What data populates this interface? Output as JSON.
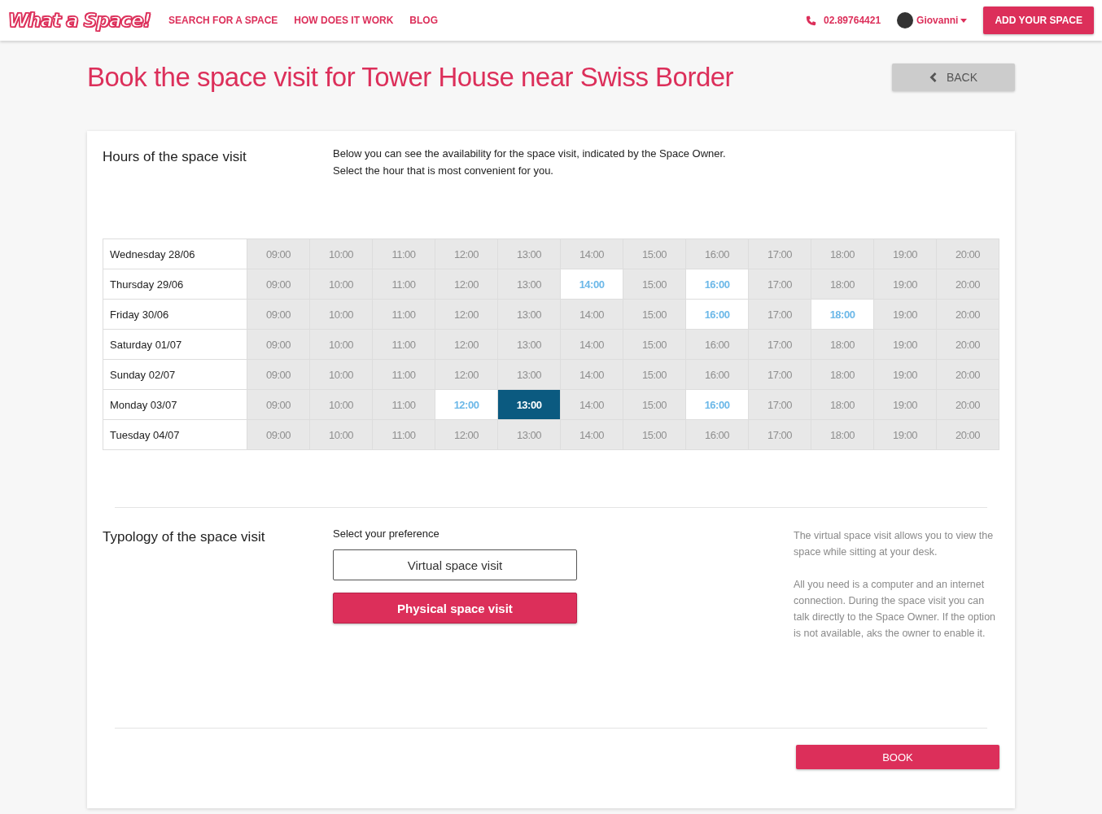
{
  "header": {
    "logo": "What a Space!",
    "nav": [
      {
        "label": "SEARCH FOR A SPACE"
      },
      {
        "label": "HOW DOES IT WORK"
      },
      {
        "label": "BLOG"
      }
    ],
    "phone": "02.89764421",
    "user": "Giovanni",
    "cta": "ADD YOUR SPACE"
  },
  "page": {
    "title": "Book the space visit for Tower House near Swiss Border",
    "back": "BACK"
  },
  "hours": {
    "heading": "Hours of the space visit",
    "intro": [
      "Below you can see the availability for the space  visit, indicated by the Space Owner.",
      "Select the hour that is most convenient for you."
    ],
    "rows": [
      {
        "day": "Wednesday 28/06",
        "slots": [
          {
            "time": "09:00",
            "available": false,
            "selected": false
          },
          {
            "time": "10:00",
            "available": false,
            "selected": false
          },
          {
            "time": "11:00",
            "available": false,
            "selected": false
          },
          {
            "time": "12:00",
            "available": false,
            "selected": false
          },
          {
            "time": "13:00",
            "available": false,
            "selected": false
          },
          {
            "time": "14:00",
            "available": false,
            "selected": false
          },
          {
            "time": "15:00",
            "available": false,
            "selected": false
          },
          {
            "time": "16:00",
            "available": false,
            "selected": false
          },
          {
            "time": "17:00",
            "available": false,
            "selected": false
          },
          {
            "time": "18:00",
            "available": false,
            "selected": false
          },
          {
            "time": "19:00",
            "available": false,
            "selected": false
          },
          {
            "time": "20:00",
            "available": false,
            "selected": false
          }
        ]
      },
      {
        "day": "Thursday 29/06",
        "slots": [
          {
            "time": "09:00",
            "available": false,
            "selected": false
          },
          {
            "time": "10:00",
            "available": false,
            "selected": false
          },
          {
            "time": "11:00",
            "available": false,
            "selected": false
          },
          {
            "time": "12:00",
            "available": false,
            "selected": false
          },
          {
            "time": "13:00",
            "available": false,
            "selected": false
          },
          {
            "time": "14:00",
            "available": true,
            "selected": false
          },
          {
            "time": "15:00",
            "available": false,
            "selected": false
          },
          {
            "time": "16:00",
            "available": true,
            "selected": false
          },
          {
            "time": "17:00",
            "available": false,
            "selected": false
          },
          {
            "time": "18:00",
            "available": false,
            "selected": false
          },
          {
            "time": "19:00",
            "available": false,
            "selected": false
          },
          {
            "time": "20:00",
            "available": false,
            "selected": false
          }
        ]
      },
      {
        "day": "Friday 30/06",
        "slots": [
          {
            "time": "09:00",
            "available": false,
            "selected": false
          },
          {
            "time": "10:00",
            "available": false,
            "selected": false
          },
          {
            "time": "11:00",
            "available": false,
            "selected": false
          },
          {
            "time": "12:00",
            "available": false,
            "selected": false
          },
          {
            "time": "13:00",
            "available": false,
            "selected": false
          },
          {
            "time": "14:00",
            "available": false,
            "selected": false
          },
          {
            "time": "15:00",
            "available": false,
            "selected": false
          },
          {
            "time": "16:00",
            "available": true,
            "selected": false
          },
          {
            "time": "17:00",
            "available": false,
            "selected": false
          },
          {
            "time": "18:00",
            "available": true,
            "selected": false
          },
          {
            "time": "19:00",
            "available": false,
            "selected": false
          },
          {
            "time": "20:00",
            "available": false,
            "selected": false
          }
        ]
      },
      {
        "day": "Saturday 01/07",
        "slots": [
          {
            "time": "09:00",
            "available": false,
            "selected": false
          },
          {
            "time": "10:00",
            "available": false,
            "selected": false
          },
          {
            "time": "11:00",
            "available": false,
            "selected": false
          },
          {
            "time": "12:00",
            "available": false,
            "selected": false
          },
          {
            "time": "13:00",
            "available": false,
            "selected": false
          },
          {
            "time": "14:00",
            "available": false,
            "selected": false
          },
          {
            "time": "15:00",
            "available": false,
            "selected": false
          },
          {
            "time": "16:00",
            "available": false,
            "selected": false
          },
          {
            "time": "17:00",
            "available": false,
            "selected": false
          },
          {
            "time": "18:00",
            "available": false,
            "selected": false
          },
          {
            "time": "19:00",
            "available": false,
            "selected": false
          },
          {
            "time": "20:00",
            "available": false,
            "selected": false
          }
        ]
      },
      {
        "day": "Sunday 02/07",
        "slots": [
          {
            "time": "09:00",
            "available": false,
            "selected": false
          },
          {
            "time": "10:00",
            "available": false,
            "selected": false
          },
          {
            "time": "11:00",
            "available": false,
            "selected": false
          },
          {
            "time": "12:00",
            "available": false,
            "selected": false
          },
          {
            "time": "13:00",
            "available": false,
            "selected": false
          },
          {
            "time": "14:00",
            "available": false,
            "selected": false
          },
          {
            "time": "15:00",
            "available": false,
            "selected": false
          },
          {
            "time": "16:00",
            "available": false,
            "selected": false
          },
          {
            "time": "17:00",
            "available": false,
            "selected": false
          },
          {
            "time": "18:00",
            "available": false,
            "selected": false
          },
          {
            "time": "19:00",
            "available": false,
            "selected": false
          },
          {
            "time": "20:00",
            "available": false,
            "selected": false
          }
        ]
      },
      {
        "day": "Monday 03/07",
        "slots": [
          {
            "time": "09:00",
            "available": false,
            "selected": false
          },
          {
            "time": "10:00",
            "available": false,
            "selected": false
          },
          {
            "time": "11:00",
            "available": false,
            "selected": false
          },
          {
            "time": "12:00",
            "available": true,
            "selected": false
          },
          {
            "time": "13:00",
            "available": true,
            "selected": true
          },
          {
            "time": "14:00",
            "available": false,
            "selected": false
          },
          {
            "time": "15:00",
            "available": false,
            "selected": false
          },
          {
            "time": "16:00",
            "available": true,
            "selected": false
          },
          {
            "time": "17:00",
            "available": false,
            "selected": false
          },
          {
            "time": "18:00",
            "available": false,
            "selected": false
          },
          {
            "time": "19:00",
            "available": false,
            "selected": false
          },
          {
            "time": "20:00",
            "available": false,
            "selected": false
          }
        ]
      },
      {
        "day": "Tuesday 04/07",
        "slots": [
          {
            "time": "09:00",
            "available": false,
            "selected": false
          },
          {
            "time": "10:00",
            "available": false,
            "selected": false
          },
          {
            "time": "11:00",
            "available": false,
            "selected": false
          },
          {
            "time": "12:00",
            "available": false,
            "selected": false
          },
          {
            "time": "13:00",
            "available": false,
            "selected": false
          },
          {
            "time": "14:00",
            "available": false,
            "selected": false
          },
          {
            "time": "15:00",
            "available": false,
            "selected": false
          },
          {
            "time": "16:00",
            "available": false,
            "selected": false
          },
          {
            "time": "17:00",
            "available": false,
            "selected": false
          },
          {
            "time": "18:00",
            "available": false,
            "selected": false
          },
          {
            "time": "19:00",
            "available": false,
            "selected": false
          },
          {
            "time": "20:00",
            "available": false,
            "selected": false
          }
        ]
      }
    ]
  },
  "typology": {
    "heading": "Typology of the space visit",
    "prompt": "Select your preference",
    "options": [
      {
        "label": "Virtual space visit",
        "selected": false
      },
      {
        "label": "Physical space visit",
        "selected": true
      }
    ],
    "notes": [
      "The virtual space visit allows you to view the space while sitting at your desk.",
      "All you need is a computer and an internet connection. During the space visit you can talk directly to the Space Owner. If the option is not available, aks the owner to enable it."
    ]
  },
  "book": "BOOK"
}
